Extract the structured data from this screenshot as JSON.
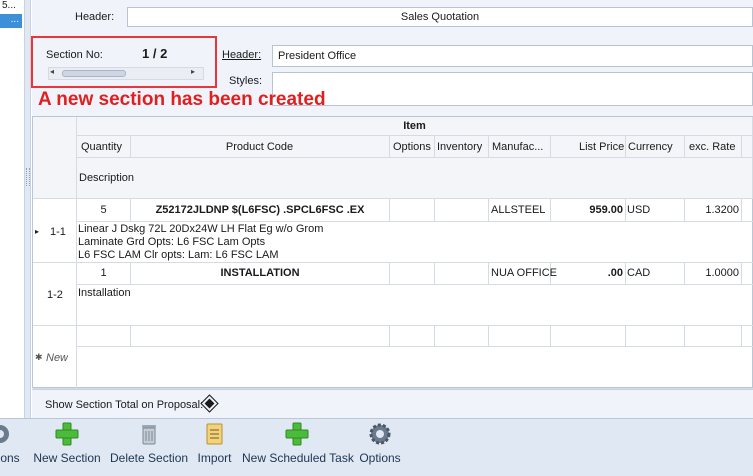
{
  "left_list": {
    "row1": "5...",
    "row2": "..."
  },
  "header": {
    "label": "Header:",
    "value": "Sales Quotation"
  },
  "section": {
    "label": "Section No:",
    "value": "1 / 2"
  },
  "section_header": {
    "label": "Header:",
    "value": "President Office"
  },
  "styles": {
    "label": "Styles:",
    "value": ""
  },
  "notice": "A new section has been created",
  "grid": {
    "group_header": "Item",
    "columns": [
      "Quantity",
      "Product Code",
      "Options",
      "Inventory",
      "Manufac...",
      "List Price",
      "Currency",
      "exc. Rate"
    ],
    "description_header": "Description",
    "rows": [
      {
        "row_id": "1-1",
        "quantity": "5",
        "product_code": "Z52172JLDNP $(L6FSC) .SPCL6FSC .EX",
        "options": "",
        "inventory": "",
        "manufacturer": "ALLSTEEL",
        "list_price": "959.00",
        "currency": "USD",
        "exc_rate": "1.3200",
        "description": [
          "Linear J Dskg 72L 20Dx24W LH Flat Eg w/o Grom",
          "Laminate Grd Opts: L6 FSC Lam Opts",
          "L6 FSC LAM Clr opts: Lam: L6 FSC LAM"
        ]
      },
      {
        "row_id": "1-2",
        "quantity": "1",
        "product_code": "INSTALLATION",
        "options": "",
        "inventory": "",
        "manufacturer": "NUA OFFICE",
        "list_price": ".00",
        "currency": "CAD",
        "exc_rate": "1.0000",
        "description": [
          "Installation"
        ]
      }
    ],
    "new_row_label": "New"
  },
  "show_total": {
    "label": "Show Section Total on Proposal:"
  },
  "toolbar": {
    "options_partial": "ons",
    "new_section": "New Section",
    "delete_section": "Delete Section",
    "import": "Import",
    "new_scheduled_task": "New Scheduled Task",
    "options": "Options"
  },
  "icons": [
    "gear-icon",
    "plus-icon",
    "trash-icon",
    "import-icon",
    "plus-icon",
    "gear-icon",
    "row-pointer-icon",
    "new-row-icon"
  ],
  "colors": {
    "notice": "#e02020",
    "section_border": "#e8363a",
    "selection": "#3c8fd8",
    "plus_green": "#4cbb3c"
  }
}
